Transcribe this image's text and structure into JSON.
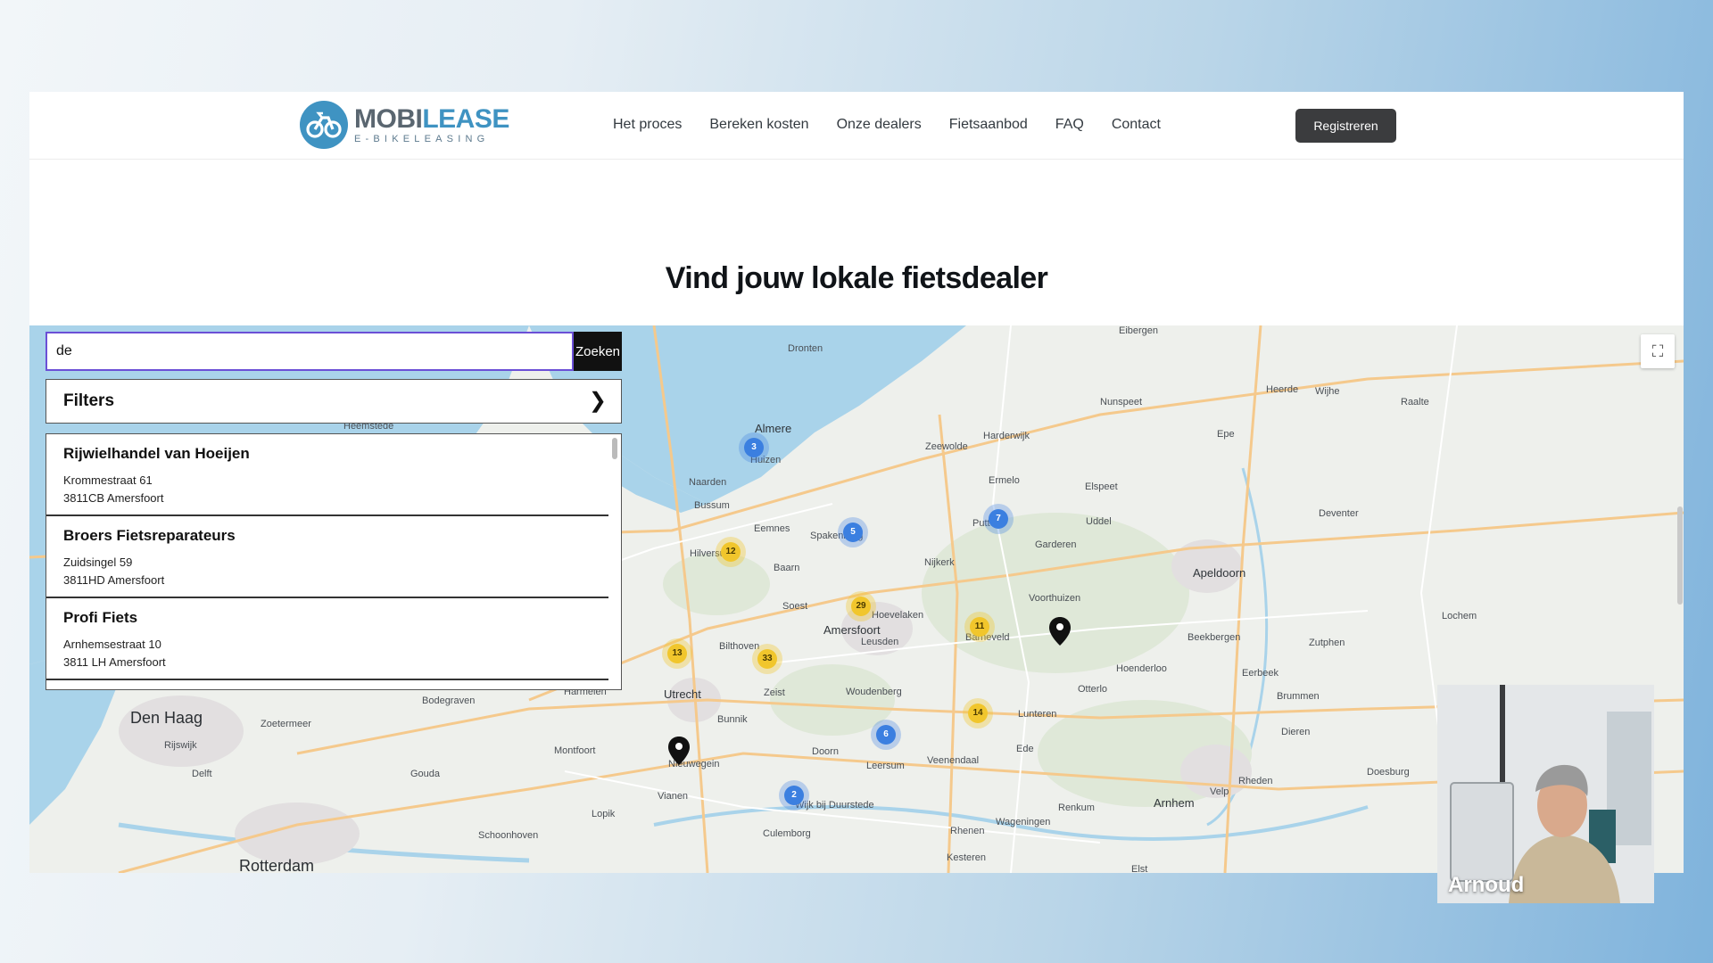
{
  "logo": {
    "name_part1": "MOBI",
    "name_part2": "LEASE",
    "tagline": "E-BIKELEASING"
  },
  "nav": [
    "Het proces",
    "Bereken kosten",
    "Onze dealers",
    "Fietsaanbod",
    "FAQ",
    "Contact"
  ],
  "register_label": "Registreren",
  "page_title": "Vind jouw lokale fietsdealer",
  "search": {
    "value": "de",
    "button_label": "Zoeken"
  },
  "filters_label": "Filters",
  "dealers": [
    {
      "name": "Rijwielhandel van Hoeijen",
      "street": "Krommestraat 61",
      "city": "3811CB Amersfoort"
    },
    {
      "name": "Broers Fietsreparateurs",
      "street": "Zuidsingel 59",
      "city": "3811HD Amersfoort"
    },
    {
      "name": "Profi Fiets",
      "street": "Arnhemsestraat 10",
      "city": "3811 LH Amersfoort"
    }
  ],
  "map": {
    "places": [
      "Almere",
      "Huizen",
      "Naarden",
      "Bussum",
      "Eemnes",
      "Hilversum",
      "Baarn",
      "Soest",
      "Spakenburg",
      "Nijkerk",
      "Zeewolde",
      "Harderwijk",
      "Ermelo",
      "Putten",
      "Garderen",
      "Barneveld",
      "Leusden",
      "Hoevelaken",
      "Amersfoort",
      "Bilthoven",
      "Utrecht",
      "Zeist",
      "Bunnik",
      "Woudenberg",
      "Veenendaal",
      "Ede",
      "Doorn",
      "Leersum",
      "Nieuwegein",
      "Vianen",
      "Culemborg",
      "Wijk bij Duurstede",
      "Rhenen",
      "Wageningen",
      "Renkum",
      "Arnhem",
      "Elst",
      "Kesteren",
      "Den Haag",
      "Rotterdam",
      "Zoetermeer",
      "Rijswijk",
      "Delft",
      "Gouda",
      "Bodegraven",
      "Harmelen",
      "Montfoort",
      "Lopik",
      "Schoonhoven",
      "Apeldoorn",
      "Deventer",
      "Zutphen",
      "Lochem",
      "Otterlo",
      "Hoenderloo",
      "Beekbergen",
      "Eerbeek",
      "Brummen",
      "Dieren",
      "Doesburg",
      "Velp",
      "Rheden",
      "Epe",
      "Heerde",
      "Wijhe",
      "Raalte",
      "Dronten",
      "Nunspeet",
      "Elspeet",
      "Uddel",
      "Lunteren",
      "Voorthuizen",
      "Heemstede",
      "Eibergen"
    ],
    "clusters": [
      {
        "label": "3",
        "color": "blue"
      },
      {
        "label": "5",
        "color": "blue"
      },
      {
        "label": "7",
        "color": "blue"
      },
      {
        "label": "12",
        "color": "yellow"
      },
      {
        "label": "29",
        "color": "yellow"
      },
      {
        "label": "11",
        "color": "yellow"
      },
      {
        "label": "13",
        "color": "yellow"
      },
      {
        "label": "33",
        "color": "yellow"
      },
      {
        "label": "14",
        "color": "yellow"
      },
      {
        "label": "6",
        "color": "blue"
      },
      {
        "label": "2",
        "color": "blue"
      }
    ]
  },
  "webcam": {
    "name": "Arnoud"
  },
  "colors": {
    "brand_blue": "#3f93c2",
    "button_dark": "#3b3c3e",
    "cluster_yellow": "#f1c62c",
    "cluster_blue": "#3b7fe0",
    "search_border": "#6b4fd6"
  }
}
